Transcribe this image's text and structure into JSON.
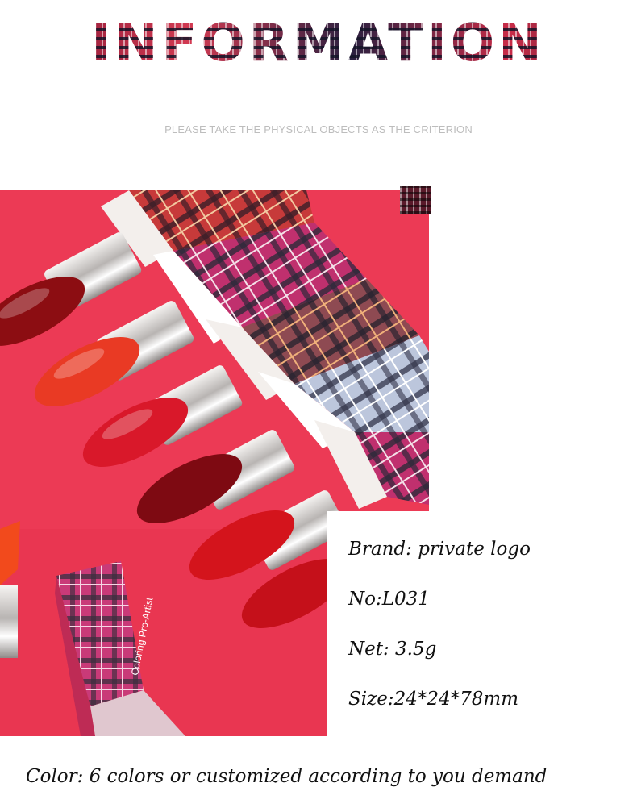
{
  "header": {
    "title": "INFORMATION",
    "subtitle": "PLEASE TAKE THE PHYSICAL OBJECTS AS THE CRITERION"
  },
  "photo": {
    "box_text": "Coloring Pro-Artist",
    "colors": {
      "background": "#ec3a55",
      "lipstick_dark": "#8c0d12",
      "lipstick_orange": "#e93a24",
      "lipstick_red": "#d9182a",
      "chrome": "#d9d6d3",
      "plaid_pink": "#c0306e"
    }
  },
  "specs": {
    "brand": "Brand: private logo",
    "number": "No:L031",
    "net": "Net: 3.5g",
    "size": "Size:24*24*78mm",
    "color": "Color: 6 colors or customized according to you demand"
  }
}
